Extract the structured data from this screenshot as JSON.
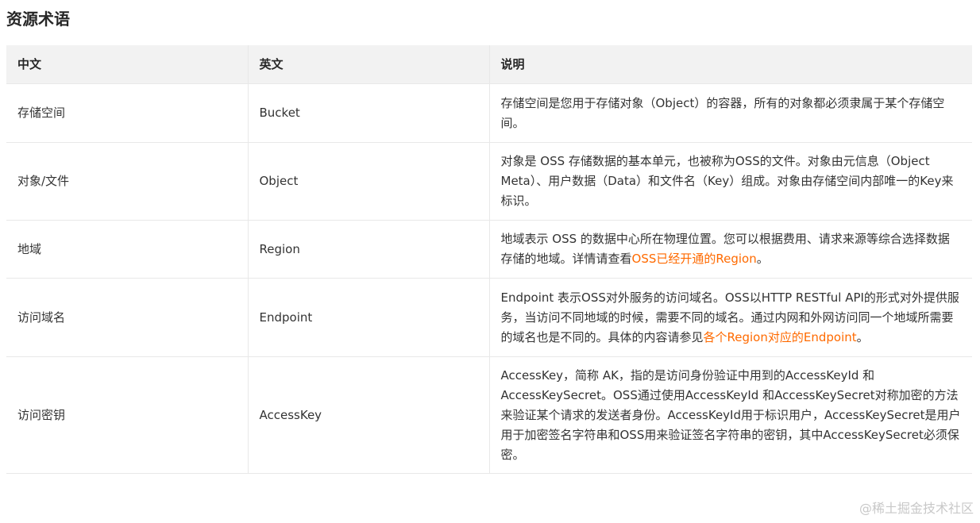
{
  "section": {
    "title": "资源术语"
  },
  "table": {
    "headers": {
      "zh": "中文",
      "en": "英文",
      "desc": "说明"
    },
    "rows": [
      {
        "zh": "存储空间",
        "en": "Bucket",
        "desc_text": "存储空间是您用于存储对象（Object）的容器，所有的对象都必须隶属于某个存储空间。"
      },
      {
        "zh": "对象/文件",
        "en": "Object",
        "desc_text": "对象是 OSS 存储数据的基本单元，也被称为OSS的文件。对象由元信息（Object Meta）、用户数据（Data）和文件名（Key）组成。对象由存储空间内部唯一的Key来标识。"
      },
      {
        "zh": "地域",
        "en": "Region",
        "desc_before": "地域表示 OSS 的数据中心所在物理位置。您可以根据费用、请求来源等综合选择数据存储的地域。详情请查看",
        "desc_link": "OSS已经开通的Region",
        "desc_after": "。"
      },
      {
        "zh": "访问域名",
        "en": "Endpoint",
        "desc_before": "Endpoint 表示OSS对外服务的访问域名。OSS以HTTP RESTful API的形式对外提供服务，当访问不同地域的时候，需要不同的域名。通过内网和外网访问同一个地域所需要的域名也是不同的。具体的内容请参见",
        "desc_link": "各个Region对应的Endpoint",
        "desc_after": "。"
      },
      {
        "zh": "访问密钥",
        "en": "AccessKey",
        "desc_text": "AccessKey，简称 AK，指的是访问身份验证中用到的AccessKeyId 和AccessKeySecret。OSS通过使用AccessKeyId 和AccessKeySecret对称加密的方法来验证某个请求的发送者身份。AccessKeyId用于标识用户，AccessKeySecret是用户用于加密签名字符串和OSS用来验证签名字符串的密钥，其中AccessKeySecret必须保密。"
      }
    ]
  },
  "watermark": {
    "text": "@稀土掘金技术社区"
  },
  "colors": {
    "link": "#ff6a00",
    "header_bg": "#f2f2f2",
    "border": "#e8e8e8"
  }
}
